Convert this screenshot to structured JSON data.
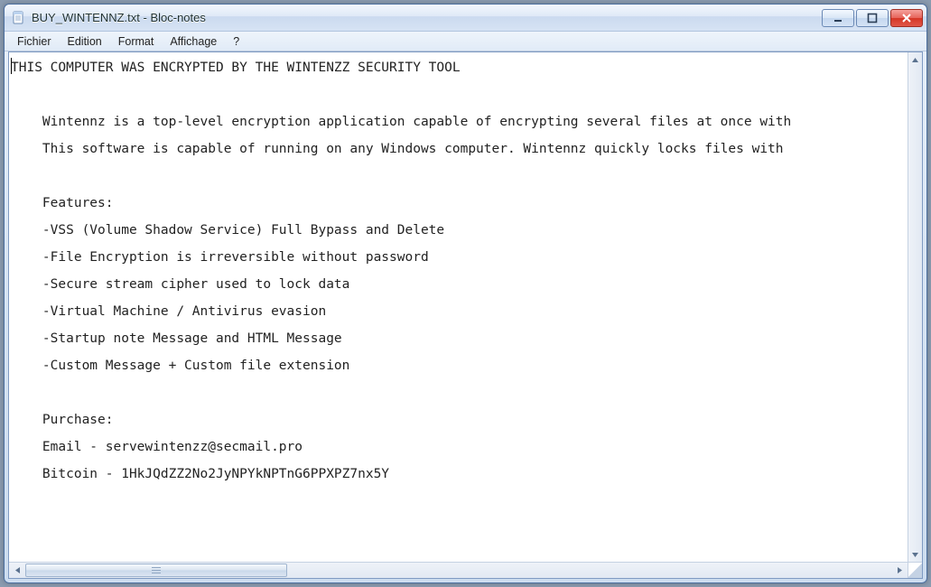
{
  "window": {
    "title": "BUY_WINTENNZ.txt - Bloc-notes",
    "icon_name": "notepad-icon"
  },
  "menubar": {
    "items": [
      "Fichier",
      "Edition",
      "Format",
      "Affichage",
      "?"
    ]
  },
  "document": {
    "lines": [
      "THIS COMPUTER WAS ENCRYPTED BY THE WINTENZZ SECURITY TOOL",
      "",
      "    Wintennz is a top-level encryption application capable of encrypting several files at once with",
      "    This software is capable of running on any Windows computer. Wintennz quickly locks files with ",
      "",
      "    Features:",
      "    -VSS (Volume Shadow Service) Full Bypass and Delete",
      "    -File Encryption is irreversible without password",
      "    -Secure stream cipher used to lock data",
      "    -Virtual Machine / Antivirus evasion",
      "    -Startup note Message and HTML Message",
      "    -Custom Message + Custom file extension",
      "",
      "    Purchase:",
      "    Email - servewintenzz@secmail.pro",
      "    Bitcoin - 1HkJQdZZ2No2JyNPYkNPTnG6PPXPZ7nx5Y"
    ]
  },
  "scroll": {
    "horizontal_thumb_ratio": 0.3
  },
  "colors": {
    "window_border": "#4b6e9e",
    "close_button": "#d53525",
    "text": "#222222"
  }
}
